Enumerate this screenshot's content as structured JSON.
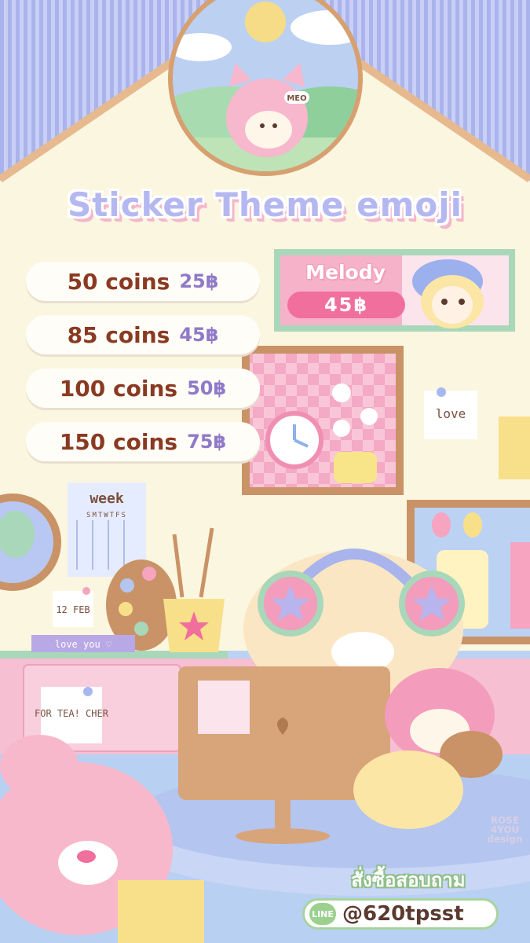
{
  "title": "Sticker Theme emoji",
  "prices": [
    {
      "coins": "50 coins",
      "baht": "25฿"
    },
    {
      "coins": "85 coins",
      "baht": "45฿"
    },
    {
      "coins": "100 coins",
      "baht": "50฿"
    },
    {
      "coins": "150 coins",
      "baht": "75฿"
    }
  ],
  "melody": {
    "name": "Melody",
    "price": "45฿"
  },
  "notes": {
    "love_note": "love",
    "calendar_title": "week",
    "calendar_days": "SMTWTFS",
    "date_note": "12 FEB",
    "love_you": "love you ♡",
    "for_teacher": "FOR TEA! CHER",
    "badge_meo": "MEO"
  },
  "contact": {
    "order_text": "สั่งซื้อสอบถาม",
    "line_label": "LINE",
    "line_id": "@620tpsst"
  },
  "brand": "ROSE 4YOU design",
  "colors": {
    "wall": "#fbf6df",
    "stripes": "#a9b4ec",
    "title": "#b5b8f0",
    "price_text": "#8a3a22",
    "baht_text": "#8f79c8",
    "melody_pink": "#f06f9d",
    "line_green": "#9bd08f"
  }
}
